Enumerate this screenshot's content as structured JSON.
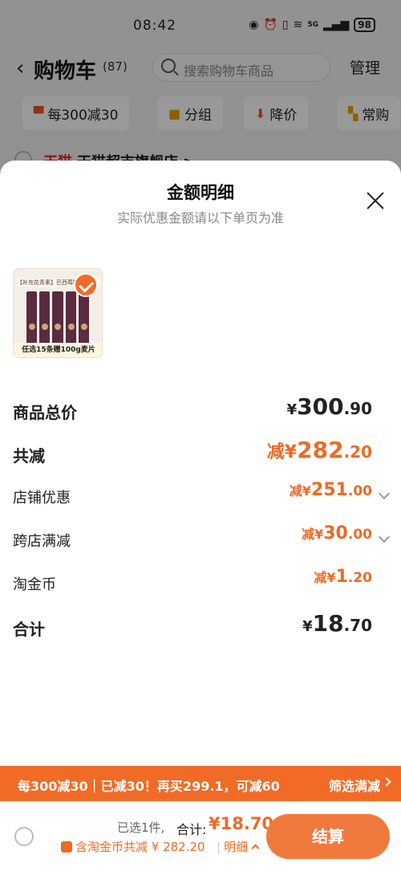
{
  "status_bar": {
    "time": "08:42",
    "network": "5G",
    "battery": "98"
  },
  "nav": {
    "title": "购物车",
    "count": "(87)",
    "search_placeholder": "搜索购物车商品",
    "manage": "管理"
  },
  "chips": [
    "每300减30",
    "分组",
    "降价",
    "常购"
  ],
  "store": {
    "badge": "天猫",
    "name": "天猫超市旗舰店 >"
  },
  "sheet": {
    "title": "金额明细",
    "subtitle": "实际优惠金额请以下单页为准",
    "product": {
      "thumb_top_text": "【补充花青素】巴西莓粉",
      "thumb_caption": "任选15条赠100g麦片"
    },
    "rows": [
      {
        "label": "商品总价",
        "prefix": "¥",
        "int": "300",
        "dec": ".90"
      },
      {
        "label": "共减",
        "prefix": "减¥",
        "int": "282",
        "dec": ".20"
      },
      {
        "label": "店铺优惠",
        "prefix": "减¥",
        "int": "251",
        "dec": ".00"
      },
      {
        "label": "跨店满减",
        "prefix": "减¥",
        "int": "30",
        "dec": ".00"
      },
      {
        "label": "淘金币",
        "prefix": "减¥",
        "int": "1",
        "dec": ".20"
      },
      {
        "label": "合计",
        "prefix": "¥",
        "int": "18",
        "dec": ".70"
      }
    ]
  },
  "promo": {
    "text": "每300减30｜已减30！再买299.1，可减60",
    "button": "筛选满减"
  },
  "bottom": {
    "selected": "已选1件,",
    "total_label": "合计:",
    "total_value": "¥18.70",
    "coin_line": "含淘金币共减 ¥ 282.20",
    "detail": "明细",
    "checkout": "结算"
  },
  "colors": {
    "accent": "#ee6a25",
    "promo_bg": "#f26b26"
  }
}
